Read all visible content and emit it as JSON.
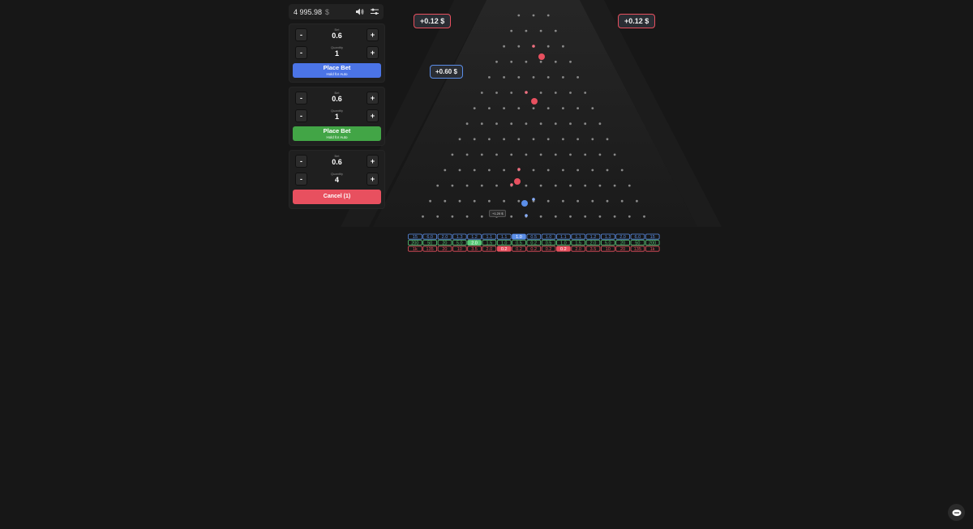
{
  "header": {
    "balance": "4 995.98",
    "currency": "$"
  },
  "cards": [
    {
      "bet_label": "Bet",
      "bet_value": "0.6",
      "qty_label": "Quantity",
      "qty_value": "1",
      "minus": "-",
      "plus": "+",
      "button_title": "Place Bet",
      "button_sub": "Hold for Auto",
      "color": "#4b74e6"
    },
    {
      "bet_label": "Bet",
      "bet_value": "0.6",
      "qty_label": "Quantity",
      "qty_value": "1",
      "minus": "-",
      "plus": "+",
      "button_title": "Place Bet",
      "button_sub": "Hold for Auto",
      "color": "#42a546"
    },
    {
      "bet_label": "Bet",
      "bet_value": "0.6",
      "qty_label": "Quantity",
      "qty_value": "4",
      "minus": "-",
      "plus": "+",
      "button_title": "Cancel (1)",
      "color": "#e8505f"
    }
  ],
  "wins": {
    "left_top": "+0.12 $",
    "right_top": "+0.12 $",
    "mid": "+0.60 $",
    "small": "+1.20 $"
  },
  "multipliers": {
    "blue": [
      "15",
      "6.0",
      "2.0",
      "1.3",
      "1.2",
      "1.1",
      "1.1",
      "1.0",
      "0.5",
      "1.0",
      "1.1",
      "1.1",
      "1.2",
      "1.3",
      "2.0",
      "6.0",
      "15"
    ],
    "green": [
      "200",
      "50",
      "20",
      "5.0",
      "2.0",
      "1.5",
      "1.0",
      "0.5",
      "0.2",
      "0.5",
      "1.0",
      "1.5",
      "2.0",
      "5.0",
      "20",
      "50",
      "200"
    ],
    "red": [
      "1k",
      "135",
      "20",
      "10",
      "3.5",
      "2.0",
      "0.2",
      "0.2",
      "0.2",
      "0.2",
      "0.2",
      "2.0",
      "3.5",
      "10",
      "20",
      "135",
      "1k"
    ],
    "highlight": {
      "blue": 7,
      "green": 4,
      "red_a": 6,
      "red_b": 10
    },
    "colors": {
      "blue": "#5b8ee8",
      "green": "#58c878",
      "red": "#e8505f"
    }
  }
}
